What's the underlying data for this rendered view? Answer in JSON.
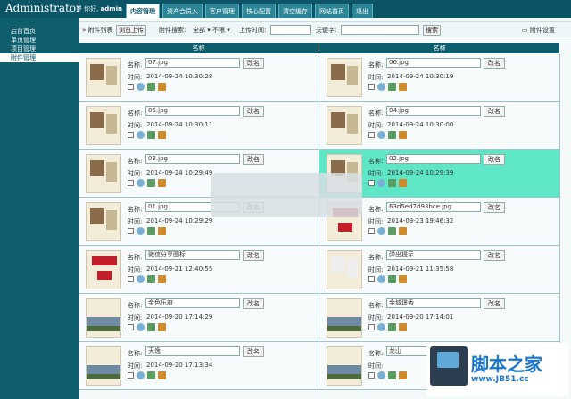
{
  "app": {
    "brand": "Administrator",
    "greeting_prefix": "※ 你好,",
    "user": "admin"
  },
  "nav_tabs": [
    "内容管理",
    "资产会员入",
    "客户管理",
    "核心配置",
    "清空缓存",
    "网站首页",
    "退出"
  ],
  "sidebar": {
    "items": [
      "后台首页",
      "单页管理",
      "项目管理",
      "附件管理"
    ],
    "active": 3
  },
  "toolbar": {
    "list_label": "» 附件列表",
    "browse_button": "浏览上传",
    "search_label": "附件搜索:",
    "filter_value": "全部 ▾ 不限 ▾",
    "upload_time_label": "上传时间:",
    "upload_time_value": "",
    "keyword_label": "关键字:",
    "keyword_value": "",
    "search_button": "搜索",
    "settings_label": "附件设置"
  },
  "grid": {
    "header": [
      "名称",
      "名称"
    ],
    "name_label": "名称:",
    "time_label": "时间:",
    "rename_button": "改名",
    "items": [
      {
        "name": "07.jpg",
        "time": "2014-09-24 10:30:28",
        "thumb": "doc"
      },
      {
        "name": "06.jpg",
        "time": "2014-09-24 10:30:19",
        "thumb": "plan"
      },
      {
        "name": "05.jpg",
        "time": "2014-09-24 10:30:11",
        "thumb": "doc"
      },
      {
        "name": "04.jpg",
        "time": "2014-09-24 10:30:00",
        "thumb": "doc"
      },
      {
        "name": "03.jpg",
        "time": "2014-09-24 10:29:49",
        "thumb": "doc"
      },
      {
        "name": "02.jpg",
        "time": "2014-09-24 10:29:39",
        "thumb": "doc",
        "highlight": true
      },
      {
        "name": "01.jpg",
        "time": "2014-09-24 10:29:29",
        "thumb": "doc"
      },
      {
        "name": "63d5ed7d93bce.jpg",
        "time": "2014-09-23 19:46:32",
        "thumb": "red"
      },
      {
        "name": "微信分享图标",
        "time": "2014-09-21 12:40:55",
        "thumb": "red"
      },
      {
        "name": "弹出提示",
        "time": "2014-09-21 11:35:58",
        "thumb": "blank"
      },
      {
        "name": "金色乐府",
        "time": "2014-09-20 17:14:29",
        "thumb": "land"
      },
      {
        "name": "金域璟香",
        "time": "2014-09-20 17:14:01",
        "thumb": "land"
      },
      {
        "name": "天逸",
        "time": "2014-09-20 17:13:34",
        "thumb": "land"
      },
      {
        "name": "龙山",
        "time": "",
        "thumb": "land"
      }
    ]
  },
  "watermark": {
    "title": "脚本之家",
    "url": "www.JB51.cc"
  }
}
